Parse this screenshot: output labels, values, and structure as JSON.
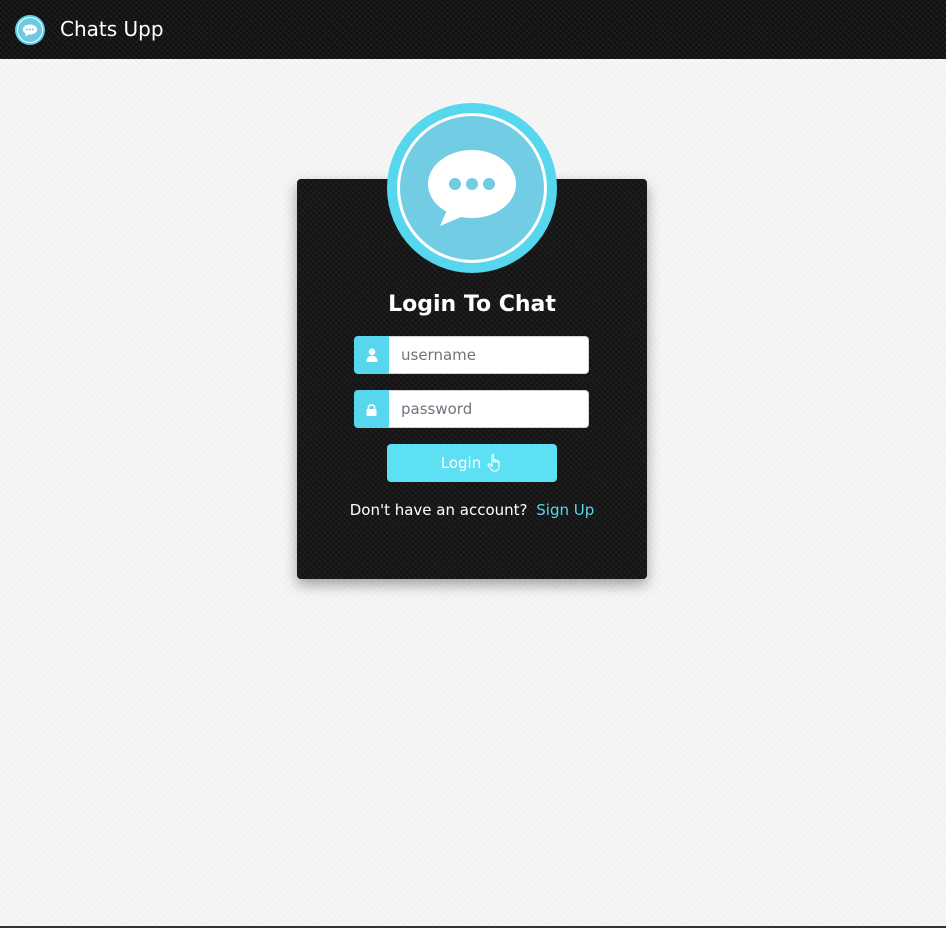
{
  "app": {
    "title": "Chats Upp",
    "logo_icon": "chat-bubble-icon"
  },
  "login": {
    "heading": "Login To Chat",
    "username_placeholder": "username",
    "password_placeholder": "password",
    "login_label": "Login",
    "signup_prompt": "Don't have an account?",
    "signup_link": "Sign Up"
  },
  "icons": {
    "username": "user-icon",
    "password": "lock-icon",
    "login": "hand-pointer-icon",
    "avatar": "chat-bubble-icon"
  },
  "colors": {
    "accent": "#56d7ee",
    "button": "#5ddff4",
    "avatar_core": "#72cce4",
    "card_bg": "#141414",
    "topbar_bg": "#111111",
    "page_bg": "#f7f7f7"
  }
}
